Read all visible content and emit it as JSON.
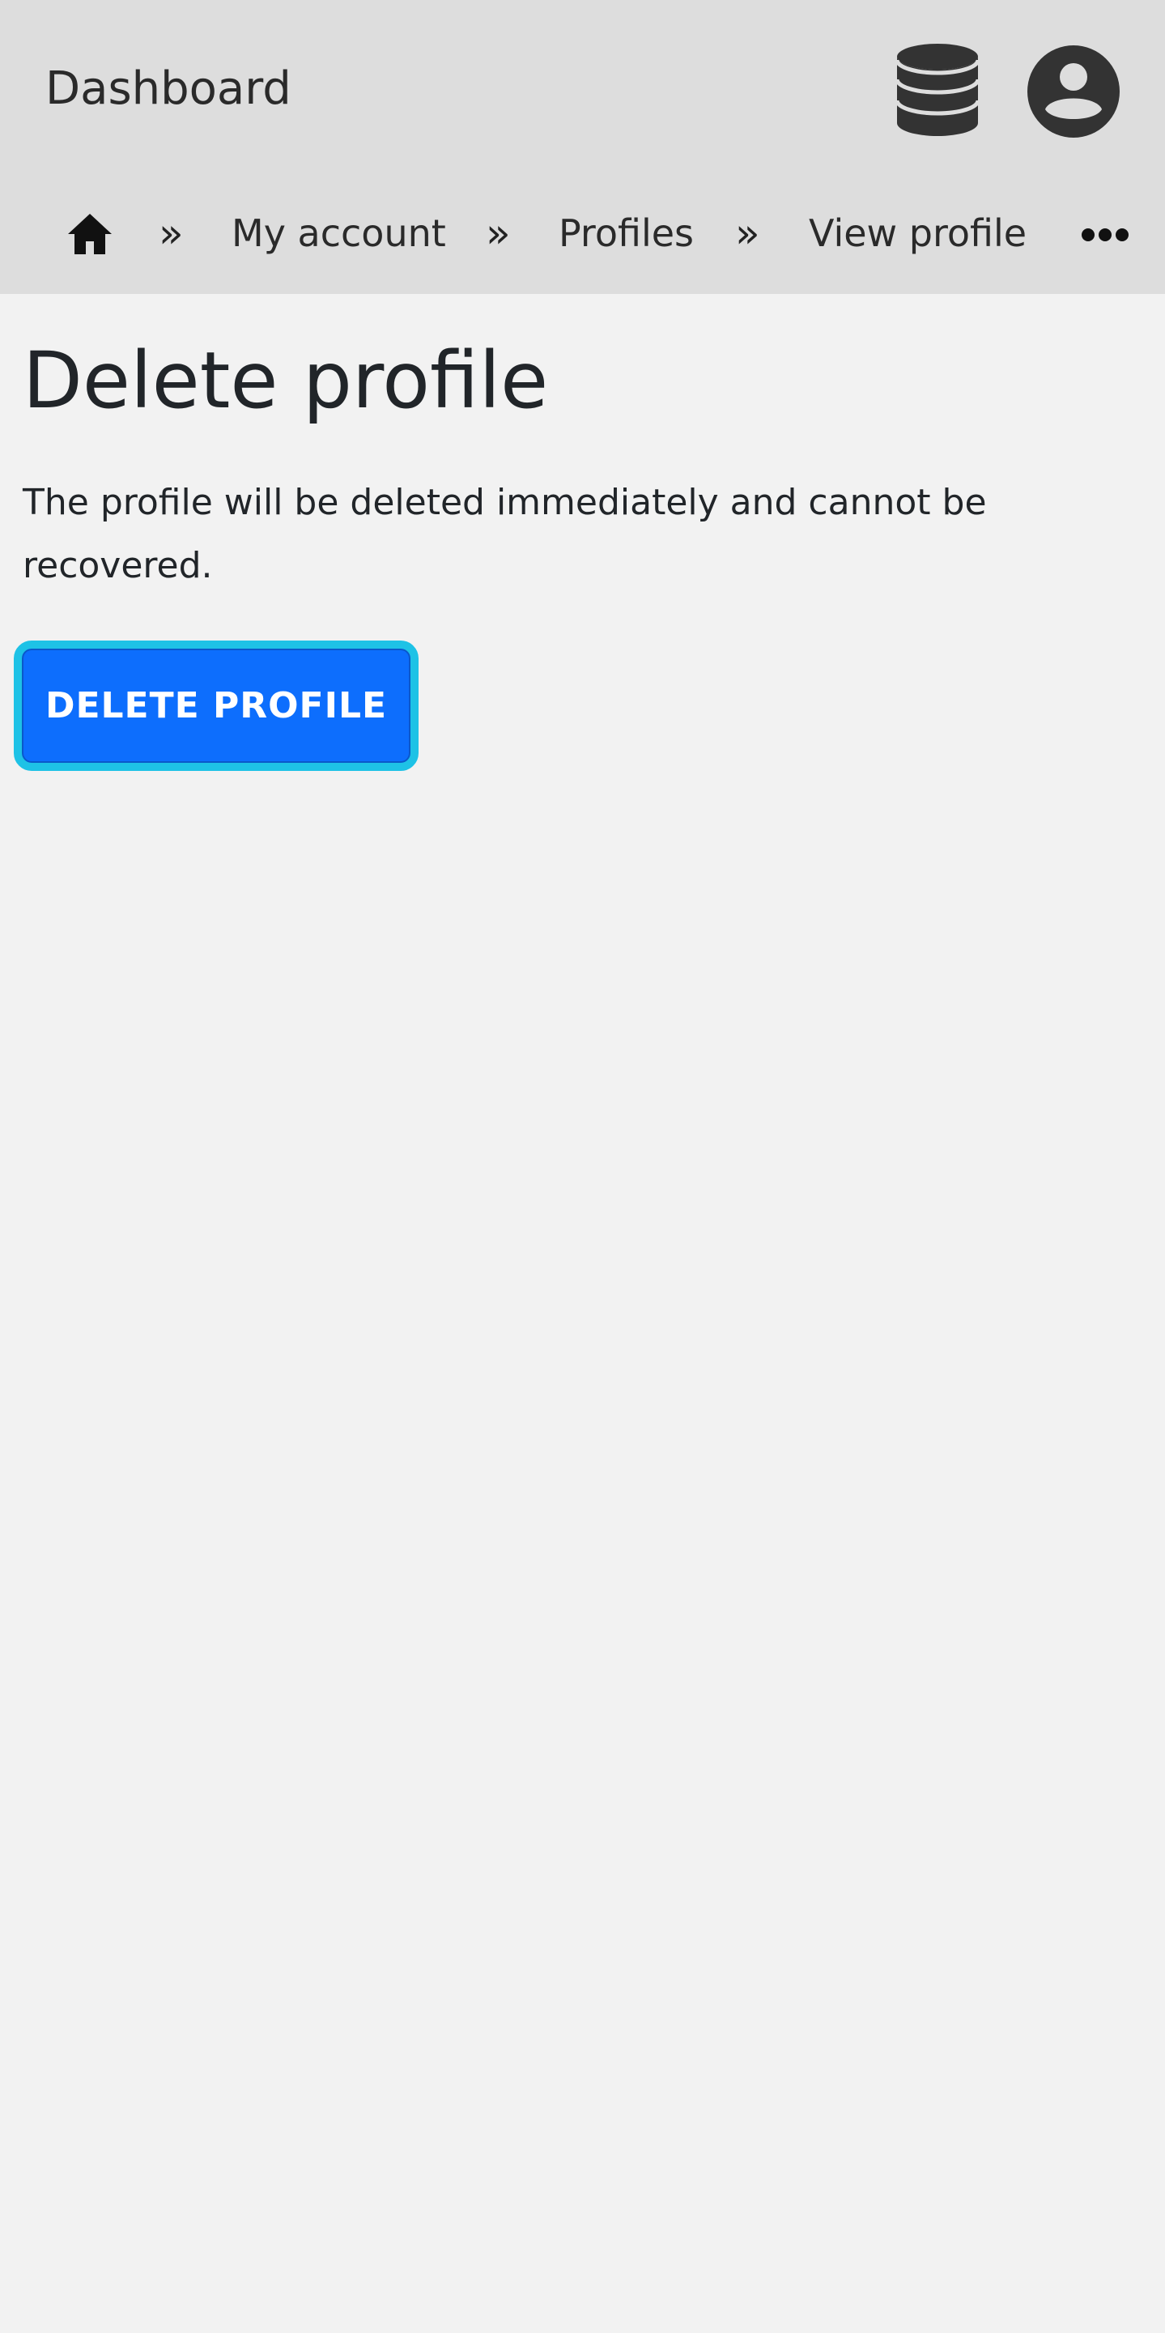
{
  "header": {
    "brand": "Dashboard",
    "icons": [
      "database-icon",
      "user-account-icon"
    ]
  },
  "breadcrumb": {
    "home_icon": "home-icon",
    "separator": "»",
    "items": [
      "My account",
      "Profiles",
      "View profile"
    ],
    "overflow_icon": "more-dots-icon"
  },
  "main": {
    "title": "Delete profile",
    "description": "The profile will be deleted immediately and cannot be recovered.",
    "delete_button": "DELETE PROFILE"
  },
  "colors": {
    "header_bg": "#dddddd",
    "page_bg": "#f2f2f2",
    "button_bg": "#0d6efd",
    "button_focus_ring": "#1ec2e6",
    "icon": "#333333"
  }
}
